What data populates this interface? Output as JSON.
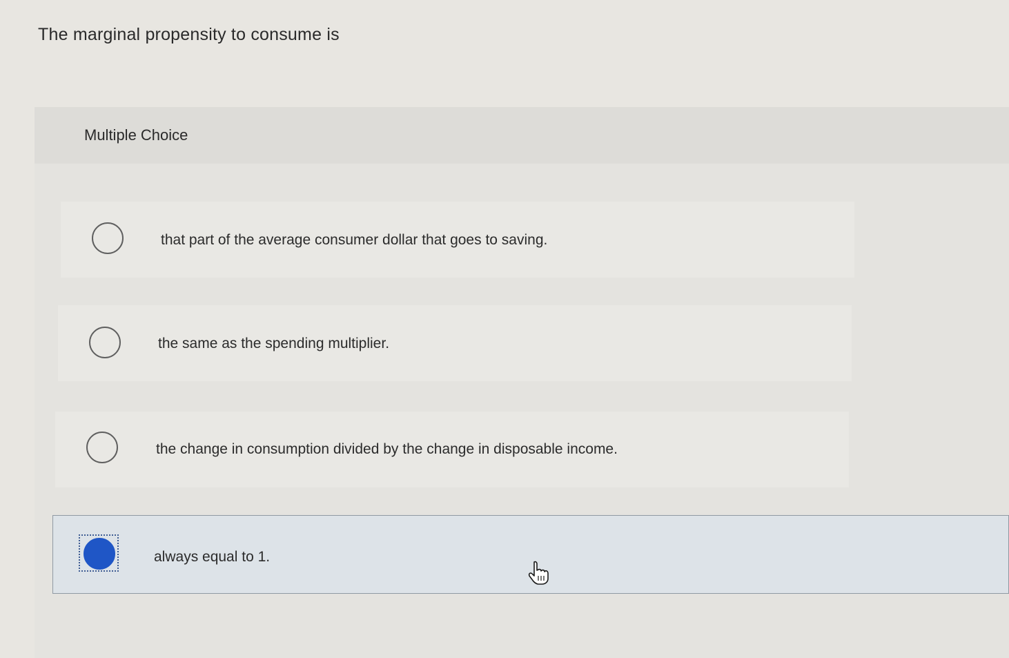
{
  "question": {
    "text": "The marginal propensity to consume is"
  },
  "panel": {
    "label": "Multiple Choice"
  },
  "options": [
    {
      "text": "that part of the average consumer dollar that goes to saving.",
      "selected": false
    },
    {
      "text": "the same as the spending multiplier.",
      "selected": false
    },
    {
      "text": "the change in consumption divided by the change in disposable income.",
      "selected": false
    },
    {
      "text": "always equal to 1.",
      "selected": true
    }
  ],
  "colors": {
    "selected_radio": "#1f56c6",
    "selected_background": "#dde3e8"
  },
  "icons": {
    "cursor": "hand-pointer-icon"
  }
}
